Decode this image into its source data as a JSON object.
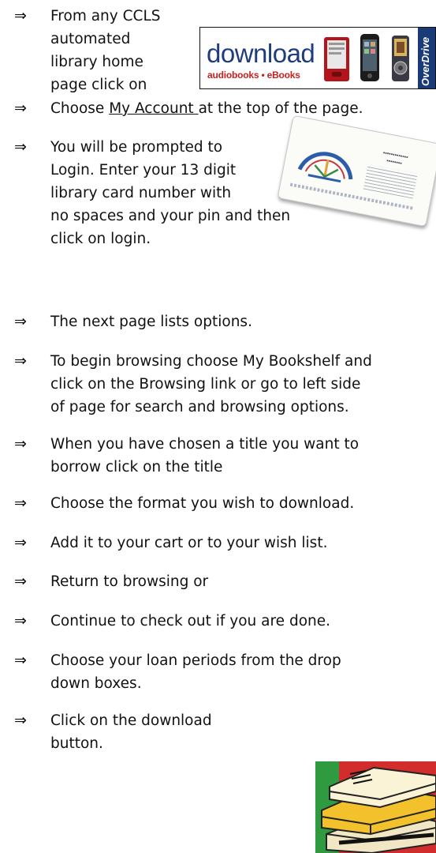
{
  "banner": {
    "word": "download",
    "sub": "audiobooks • eBooks",
    "brand": "OverDrive"
  },
  "steps": [
    {
      "lines": [
        "From any CCLS",
        "automated",
        "library home",
        "page click on"
      ]
    },
    {
      "before": "Choose ",
      "link": "My Account ",
      "after": "at the top of the page."
    },
    {
      "lines": [
        "You will be prompted to",
        "Login.  Enter your 13 digit",
        "library card number with",
        "no spaces and your pin and then",
        "click on login."
      ]
    },
    {
      "lines": [
        "The next page lists options."
      ]
    },
    {
      "lines": [
        "To begin browsing choose My Bookshelf and",
        "click on the Browsing link or go to left side",
        "of page for search and browsing options."
      ]
    },
    {
      "lines": [
        "When you have chosen a title you want to",
        "borrow click on the title"
      ]
    },
    {
      "lines": [
        "Choose the format you wish to download."
      ]
    },
    {
      "lines": [
        "Add it to your cart or to your wish list."
      ]
    },
    {
      "lines": [
        "Return to browsing or"
      ]
    },
    {
      "lines": [
        "Continue to check out if you are done."
      ]
    },
    {
      "lines": [
        "Choose your loan periods from the drop",
        "down boxes."
      ]
    },
    {
      "lines": [
        "Click on the download",
        "button."
      ]
    }
  ],
  "arrow_glyph": "⇒",
  "colors": {
    "banner_blue": "#1e3d7c",
    "banner_red": "#c81f1f",
    "book_green": "#2f9a3f",
    "book_red": "#d22c2c"
  }
}
